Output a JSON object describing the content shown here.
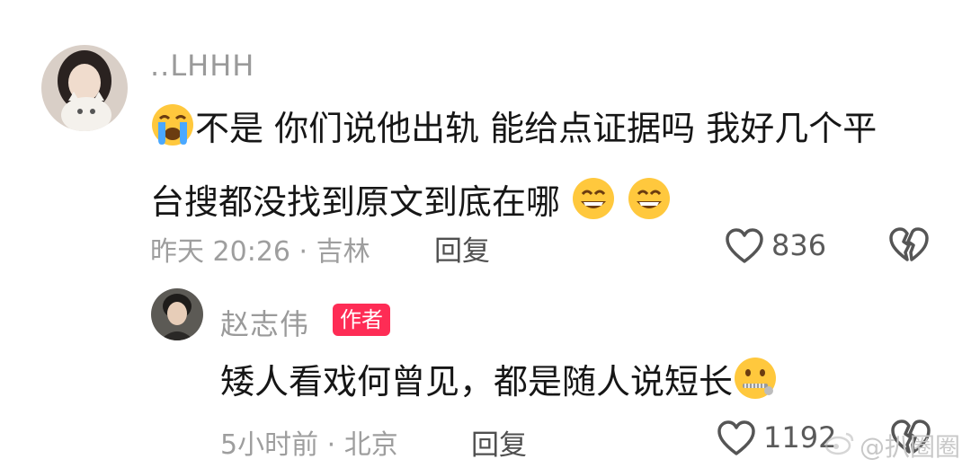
{
  "comment": {
    "username": "..LHHH",
    "text_line1": "不是 你们说他出轨 能给点证据吗 我好几个平",
    "text_line2": "台搜都没找到原文到底在哪",
    "emoji_start": "crying-face",
    "emoji_end": [
      "grinning-face",
      "grinning-face"
    ],
    "meta": "昨天 20:26 · 吉林",
    "reply_label": "回复",
    "like_count": "836"
  },
  "reply": {
    "username": "赵志伟",
    "author_badge": "作者",
    "text": "矮人看戏何曾见，都是随人说短长",
    "emoji_end": "zipper-mouth-face",
    "meta": "5小时前 · 北京",
    "reply_label": "回复",
    "like_count": "1192"
  },
  "watermark": "@扒圈圈",
  "colors": {
    "badge": "#fe2c55",
    "meta": "#9e9e9e",
    "text": "#161616",
    "icon": "#555555"
  }
}
